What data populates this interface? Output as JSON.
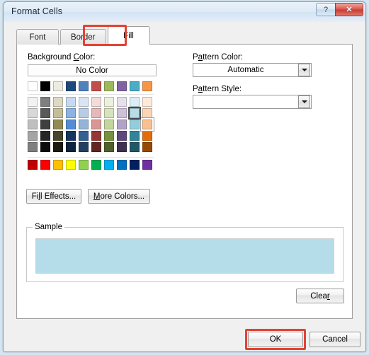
{
  "window": {
    "title": "Format Cells",
    "help_button": "?",
    "close_button": "✕",
    "help_icon": "question-mark-icon",
    "close_icon": "close-x-icon"
  },
  "tabs": [
    {
      "label": "Font",
      "active": false
    },
    {
      "label": "Border",
      "active": false
    },
    {
      "label": "Fill",
      "active": true
    }
  ],
  "annotations": {
    "color": "#e34234",
    "targets": [
      "fill-tab",
      "ok-button"
    ]
  },
  "fill_tab": {
    "background_color": {
      "label": "Background Color:",
      "no_color_label": "No Color",
      "accent_row": [
        "#ffffff",
        "#000000",
        "#eeece1",
        "#1f497d",
        "#4f81bd",
        "#c0504d",
        "#9bbb59",
        "#8064a2",
        "#4bacc6",
        "#f79646"
      ],
      "tint_rows": [
        [
          "#f2f2f2",
          "#7f7f7f",
          "#ddd9c3",
          "#c6d9f0",
          "#dbe5f1",
          "#f2dcdb",
          "#ebf1dd",
          "#e5e0ec",
          "#dbeef3",
          "#fdeada"
        ],
        [
          "#d8d8d8",
          "#595959",
          "#c4bd97",
          "#8db3e2",
          "#b8cce4",
          "#e5b9b7",
          "#d7e3bc",
          "#ccc1d9",
          "#b7dde8",
          "#fbd5b5"
        ],
        [
          "#bfbfbf",
          "#3f3f3f",
          "#938953",
          "#548dd4",
          "#95b3d7",
          "#d99694",
          "#c3d69b",
          "#b2a2c7",
          "#92cddc",
          "#fac08f"
        ],
        [
          "#a5a5a5",
          "#262626",
          "#494429",
          "#17365d",
          "#366092",
          "#953734",
          "#76923c",
          "#5f497a",
          "#31859b",
          "#e36c09"
        ],
        [
          "#7f7f7f",
          "#0c0c0c",
          "#1d1b10",
          "#0f243e",
          "#244061",
          "#632423",
          "#4f6128",
          "#3f3151",
          "#205867",
          "#974806"
        ]
      ],
      "standard_row": [
        "#c00000",
        "#ff0000",
        "#ffc000",
        "#ffff00",
        "#92d050",
        "#00b050",
        "#00b0f0",
        "#0070c0",
        "#002060",
        "#7030a0"
      ],
      "selected": {
        "row": 1,
        "col": 8,
        "color": "#b7dde8"
      },
      "hovered": {
        "row": 2,
        "col": 9,
        "color": "#fac08f"
      }
    },
    "buttons": {
      "fill_effects": "Fill Effects...",
      "more_colors": "More Colors...",
      "clear": "Clear"
    },
    "pattern_color": {
      "label": "Pattern Color:",
      "value": "Automatic",
      "arrow_icon": "chevron-down-icon"
    },
    "pattern_style": {
      "label": "Pattern Style:",
      "value": "",
      "arrow_icon": "chevron-down-icon"
    },
    "sample": {
      "legend": "Sample",
      "fill_color": "#b5dde9"
    }
  },
  "footer": {
    "ok": "OK",
    "cancel": "Cancel"
  }
}
